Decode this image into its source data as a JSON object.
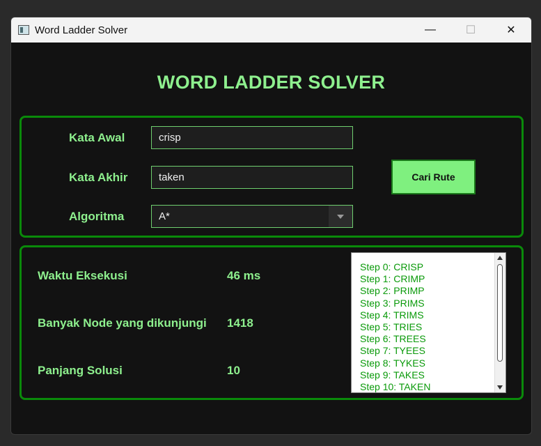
{
  "window": {
    "title": "Word Ladder Solver",
    "icon": "app-window-icon"
  },
  "heading": "WORD LADDER SOLVER",
  "form": {
    "start_label": "Kata Awal",
    "start_value": "crisp",
    "end_label": "Kata Akhir",
    "end_value": "taken",
    "algo_label": "Algoritma",
    "algo_value": "A*",
    "search_button": "Cari Rute"
  },
  "results": {
    "time_label": "Waktu Eksekusi",
    "time_value": "46 ms",
    "nodes_label": "Banyak Node yang dikunjungi",
    "nodes_value": "1418",
    "length_label": "Panjang Solusi",
    "length_value": "10"
  },
  "steps": [
    "Step 0: CRISP",
    "Step 1: CRIMP",
    "Step 2: PRIMP",
    "Step 3: PRIMS",
    "Step 4: TRIMS",
    "Step 5: TRIES",
    "Step 6: TREES",
    "Step 7: TYEES",
    "Step 8: TYKES",
    "Step 9: TAKES",
    "Step 10: TAKEN"
  ],
  "colors": {
    "accent": "#8ef08e",
    "border": "#0a8a0a",
    "button": "#7ff07f",
    "step_text": "#0a9a0a"
  }
}
